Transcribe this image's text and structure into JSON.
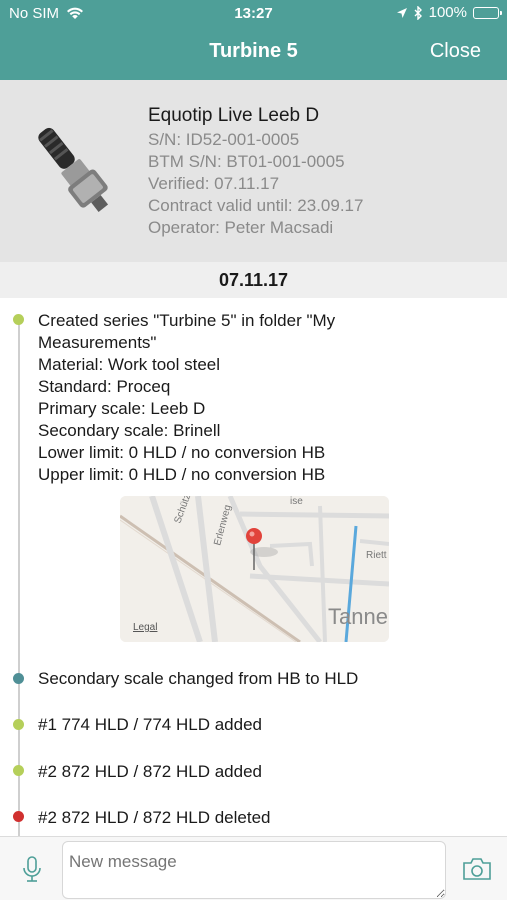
{
  "status": {
    "carrier": "No SIM",
    "time": "13:27",
    "battery": "100%",
    "battery_level": 1.0
  },
  "nav": {
    "title": "Turbine 5",
    "close_label": "Close"
  },
  "device": {
    "name": "Equotip Live Leeb D",
    "serial": "S/N: ID52-001-0005",
    "btm_serial": "BTM S/N: BT01-001-0005",
    "verified": "Verified: 07.11.17",
    "contract": "Contract valid until: 23.09.17",
    "operator": "Operator: Peter Macsadi"
  },
  "date_header": "07.11.17",
  "timeline": {
    "entries": [
      {
        "lines": [
          "Created series \"Turbine 5\" in folder \"My",
          "Measurements\"",
          "Material: Work tool steel",
          "Standard: Proceq",
          "Primary scale: Leeb D",
          "Secondary scale: Brinell",
          "Lower limit: 0 HLD / no conversion HB",
          "Upper limit: 0 HLD / no conversion HB"
        ],
        "dot_color": "#b5cf5a"
      },
      {
        "text": "Secondary scale changed from HB to HLD",
        "dot_color": "#4f8f96"
      },
      {
        "text": "#1 774 HLD / 774 HLD added",
        "dot_color": "#b5cf5a"
      },
      {
        "text": "#2 872 HLD / 872 HLD added",
        "dot_color": "#b5cf5a"
      },
      {
        "text": "#2 872 HLD / 872 HLD deleted",
        "dot_color": "#d0302f"
      }
    ]
  },
  "map": {
    "streets": [
      "Schütze",
      "Erlenweg",
      "Riett",
      "ise"
    ],
    "place": "Tanne",
    "legal": "Legal"
  },
  "compose": {
    "placeholder": "New message"
  },
  "colors": {
    "accent": "#4e9f98",
    "green": "#b5cf5a",
    "teal": "#4f8f96",
    "red": "#d0302f"
  }
}
